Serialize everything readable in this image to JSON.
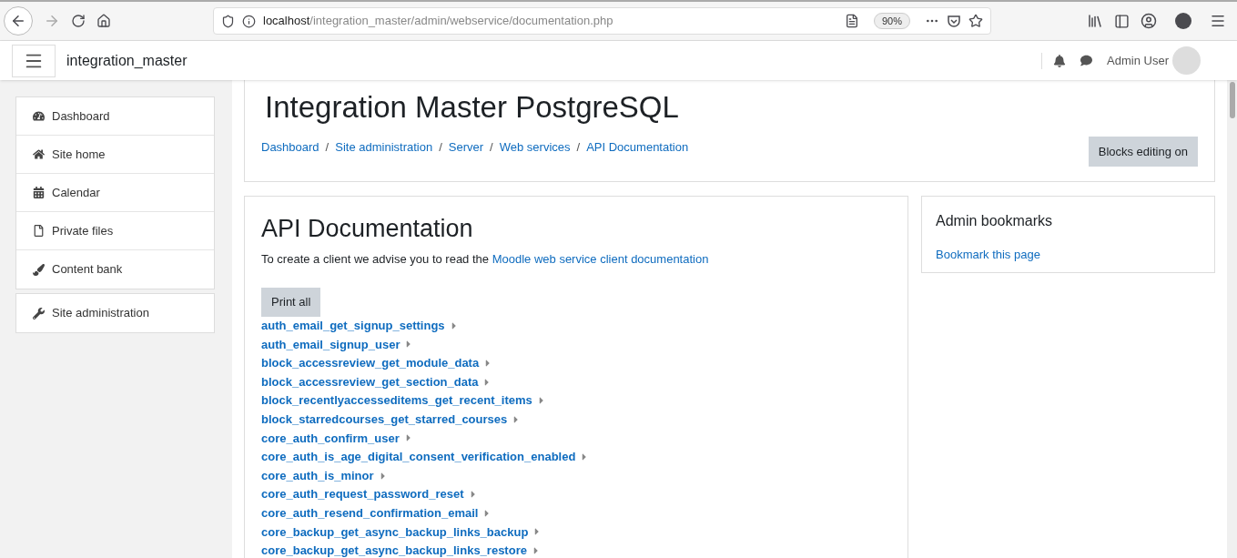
{
  "browser": {
    "url_host": "localhost",
    "url_path": "/integration_master/admin/webservice/documentation.php",
    "zoom": "90%"
  },
  "navbar": {
    "site_name": "integration_master",
    "user_name": "Admin User"
  },
  "sidebar": {
    "groups": [
      {
        "items": [
          {
            "label": "Dashboard"
          },
          {
            "label": "Site home"
          },
          {
            "label": "Calendar"
          },
          {
            "label": "Private files"
          },
          {
            "label": "Content bank"
          }
        ]
      },
      {
        "items": [
          {
            "label": "Site administration"
          }
        ]
      }
    ]
  },
  "header": {
    "title": "Integration Master PostgreSQL",
    "breadcrumbs": [
      "Dashboard",
      "Site administration",
      "Server",
      "Web services",
      "API Documentation"
    ],
    "separator": "/",
    "button": "Blocks editing on"
  },
  "main": {
    "title": "API Documentation",
    "intro": "To create a client we advise you to read the",
    "intro_link": "Moodle web service client documentation",
    "print_button": "Print all",
    "functions": [
      {
        "name": "auth_email_get_signup_settings",
        "expanded": false
      },
      {
        "name": "auth_email_signup_user",
        "expanded": false
      },
      {
        "name": "block_accessreview_get_module_data",
        "expanded": false
      },
      {
        "name": "block_accessreview_get_section_data",
        "expanded": false
      },
      {
        "name": "block_recentlyaccesseditems_get_recent_items",
        "expanded": false
      },
      {
        "name": "block_starredcourses_get_starred_courses",
        "expanded": false
      },
      {
        "name": "core_auth_confirm_user",
        "expanded": false
      },
      {
        "name": "core_auth_is_age_digital_consent_verification_enabled",
        "expanded": false
      },
      {
        "name": "core_auth_is_minor",
        "expanded": false
      },
      {
        "name": "core_auth_request_password_reset",
        "expanded": false
      },
      {
        "name": "core_auth_resend_confirmation_email",
        "expanded": false
      },
      {
        "name": "core_backup_get_async_backup_links_backup",
        "expanded": false
      },
      {
        "name": "core_backup_get_async_backup_links_restore",
        "expanded": false
      }
    ]
  },
  "bookmarks": {
    "title": "Admin bookmarks",
    "link": "Bookmark this page"
  }
}
